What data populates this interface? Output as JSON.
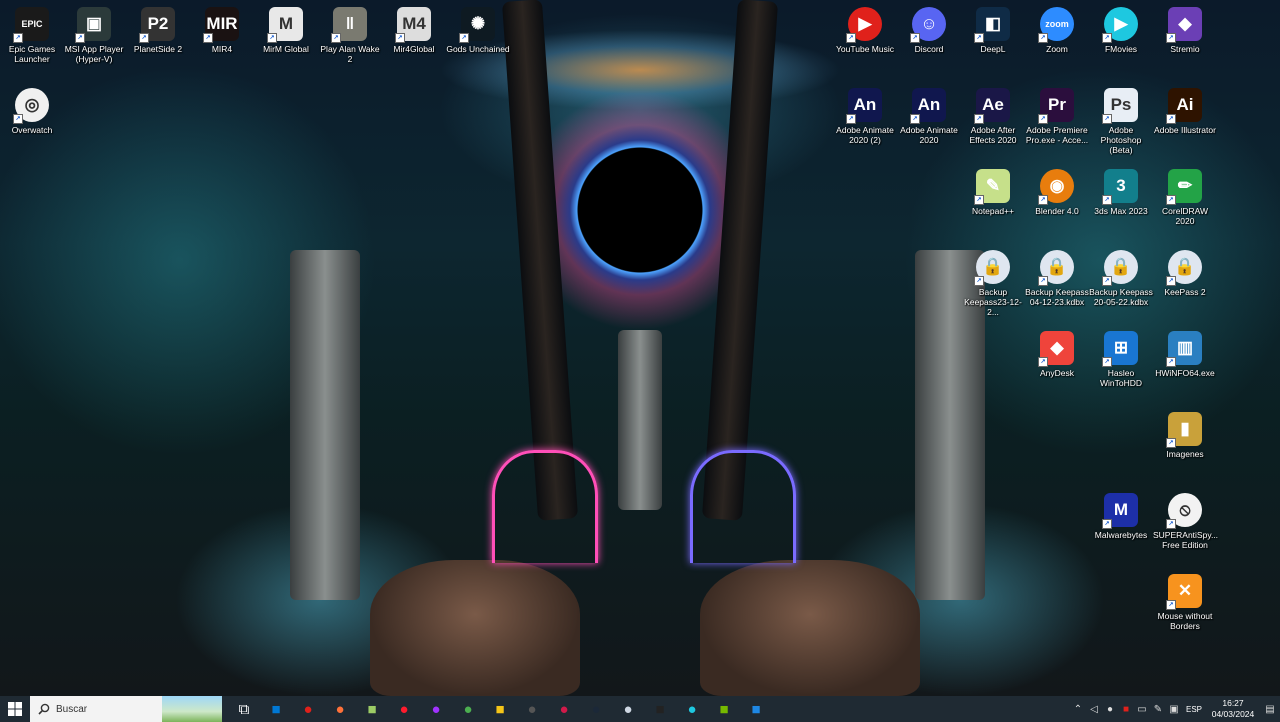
{
  "desktop_icons": [
    {
      "id": "epic",
      "label": "Epic Games Launcher",
      "glyph": "EPIC",
      "bg": "#1a1a1a"
    },
    {
      "id": "msi",
      "label": "MSI App Player (Hyper-V)",
      "glyph": "▣",
      "bg": "#2b3a3a"
    },
    {
      "id": "planetside",
      "label": "PlanetSide 2",
      "glyph": "P2",
      "bg": "#333"
    },
    {
      "id": "mir4",
      "label": "MIR4",
      "glyph": "MIR",
      "bg": "#1a1212"
    },
    {
      "id": "mirm",
      "label": "MirM Global",
      "glyph": "M",
      "bg": "#e8e8e8"
    },
    {
      "id": "alanwake",
      "label": "Play Alan Wake 2",
      "glyph": "‖",
      "bg": "#7a7a70"
    },
    {
      "id": "mir4global",
      "label": "Mir4Global",
      "glyph": "M4",
      "bg": "#dddddd"
    },
    {
      "id": "gods",
      "label": "Gods Unchained",
      "glyph": "✺",
      "bg": "#0e1a22"
    },
    {
      "id": "overwatch",
      "label": "Overwatch",
      "glyph": "◎",
      "bg": "#f0f0f0"
    },
    {
      "id": "ytmusic",
      "label": "YouTube Music",
      "glyph": "▶",
      "bg": "#e0211b"
    },
    {
      "id": "discord",
      "label": "Discord",
      "glyph": "☺",
      "bg": "#5865f2"
    },
    {
      "id": "deepl",
      "label": "DeepL",
      "glyph": "◧",
      "bg": "#0f2b46"
    },
    {
      "id": "zoom",
      "label": "Zoom",
      "glyph": "zoom",
      "bg": "#2d8cff"
    },
    {
      "id": "fmovies",
      "label": "FMovies",
      "glyph": "▶",
      "bg": "#1ec8e0"
    },
    {
      "id": "stremio",
      "label": "Stremio",
      "glyph": "◆",
      "bg": "#6b3fb5"
    },
    {
      "id": "animate2",
      "label": "Adobe Animate 2020 (2)",
      "glyph": "An",
      "bg": "#10174e"
    },
    {
      "id": "animate",
      "label": "Adobe Animate 2020",
      "glyph": "An",
      "bg": "#10174e"
    },
    {
      "id": "aftereffects",
      "label": "Adobe After Effects 2020",
      "glyph": "Ae",
      "bg": "#1a1747"
    },
    {
      "id": "premiere",
      "label": "Adobe Premiere Pro.exe - Acce...",
      "glyph": "Pr",
      "bg": "#2b0e3d"
    },
    {
      "id": "photoshop",
      "label": "Adobe Photoshop (Beta)",
      "glyph": "Ps",
      "bg": "#e8eef5"
    },
    {
      "id": "illustrator",
      "label": "Adobe Illustrator",
      "glyph": "Ai",
      "bg": "#2e1300"
    },
    {
      "id": "notepad",
      "label": "Notepad++",
      "glyph": "✎",
      "bg": "#c6e08a"
    },
    {
      "id": "blender",
      "label": "Blender 4.0",
      "glyph": "◉",
      "bg": "#e87d0d"
    },
    {
      "id": "3dsmax",
      "label": "3ds Max 2023",
      "glyph": "3",
      "bg": "#127f8c"
    },
    {
      "id": "coreldraw",
      "label": "CorelDRAW 2020",
      "glyph": "✏",
      "bg": "#23a347"
    },
    {
      "id": "backup1",
      "label": "Backup Keepass23-12-2...",
      "glyph": "🔒",
      "bg": "#dfe6f0"
    },
    {
      "id": "backup2",
      "label": "Backup Keepass 04-12-23.kdbx",
      "glyph": "🔒",
      "bg": "#dfe6f0"
    },
    {
      "id": "backup3",
      "label": "Backup Keepass 20-05-22.kdbx",
      "glyph": "🔒",
      "bg": "#dfe6f0"
    },
    {
      "id": "keepass",
      "label": "KeePass 2",
      "glyph": "🔒",
      "bg": "#dfe6f0"
    },
    {
      "id": "anydesk",
      "label": "AnyDesk",
      "glyph": "◆",
      "bg": "#ef443b"
    },
    {
      "id": "hasleo",
      "label": "Hasleo WinToHDD",
      "glyph": "⊞",
      "bg": "#1976d2"
    },
    {
      "id": "hwinfo",
      "label": "HWiNFO64.exe",
      "glyph": "▥",
      "bg": "#2a7fc1"
    },
    {
      "id": "imagenes",
      "label": "Imagenes",
      "glyph": "▮",
      "bg": "#c9a13a"
    },
    {
      "id": "malwarebytes",
      "label": "Malwarebytes",
      "glyph": "M",
      "bg": "#1d2fa8"
    },
    {
      "id": "superantispy",
      "label": "SUPERAntiSpy... Free Edition",
      "glyph": "⦸",
      "bg": "#f2f2f2"
    },
    {
      "id": "mousewb",
      "label": "Mouse without Borders",
      "glyph": "✕",
      "bg": "#f7931e"
    }
  ],
  "taskbar": {
    "search_placeholder": "Buscar",
    "apps": [
      {
        "id": "taskview",
        "glyph": "⧉",
        "color": "#ffffff"
      },
      {
        "id": "windows-store",
        "glyph": "■",
        "color": "#0078d4"
      },
      {
        "id": "youtube",
        "glyph": "●",
        "color": "#e0211b"
      },
      {
        "id": "firefox",
        "glyph": "●",
        "color": "#ff7139"
      },
      {
        "id": "notepadpp",
        "glyph": "■",
        "color": "#9ccc65"
      },
      {
        "id": "opera",
        "glyph": "●",
        "color": "#ff1b2d"
      },
      {
        "id": "messenger",
        "glyph": "●",
        "color": "#a033ff"
      },
      {
        "id": "chrome",
        "glyph": "●",
        "color": "#4caf50"
      },
      {
        "id": "explorer",
        "glyph": "■",
        "color": "#f5c518"
      },
      {
        "id": "obs",
        "glyph": "●",
        "color": "#555555"
      },
      {
        "id": "opera-gx",
        "glyph": "●",
        "color": "#d11a4a"
      },
      {
        "id": "steam",
        "glyph": "●",
        "color": "#1b2838"
      },
      {
        "id": "keepass-tb",
        "glyph": "●",
        "color": "#cfd8e3"
      },
      {
        "id": "mir4-tb",
        "glyph": "■",
        "color": "#222222"
      },
      {
        "id": "fmovies-tb",
        "glyph": "●",
        "color": "#1ec8e0"
      },
      {
        "id": "nvidia",
        "glyph": "■",
        "color": "#76b900"
      },
      {
        "id": "app-l",
        "glyph": "■",
        "color": "#1e88e5"
      }
    ],
    "tray": {
      "language": "ESP",
      "time": "16:27",
      "date": "04/03/2024"
    }
  }
}
